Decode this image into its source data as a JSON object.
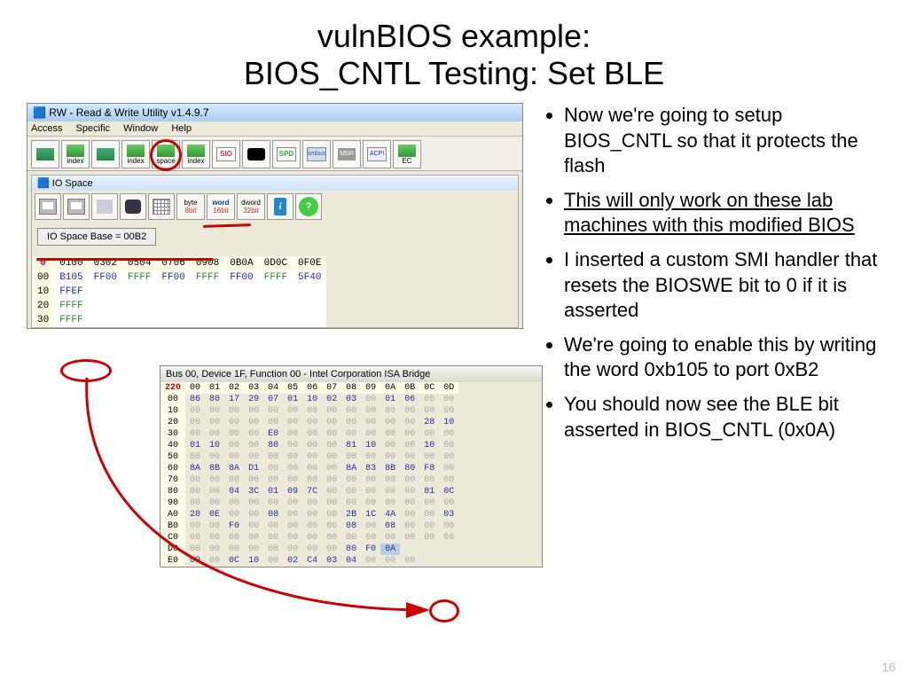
{
  "title_l1": "vulnBIOS example:",
  "title_l2": "BIOS_CNTL Testing: Set BLE",
  "pagenum": "16",
  "bullets": [
    {
      "text": "Now we're going to setup BIOS_CNTL so that it protects the flash"
    },
    {
      "text": "This will only work on these lab machines with this modified BIOS",
      "underline": true
    },
    {
      "text": "I inserted a custom SMI handler that resets the BIOSWE bit to 0 if it is asserted"
    },
    {
      "text": "We're going to enable this by writing the word 0xb105 to port 0xB2"
    },
    {
      "text": "You should now see the BLE bit asserted in BIOS_CNTL (0x0A)"
    }
  ],
  "app": {
    "title": "RW - Read & Write Utility v1.4.9.7",
    "menus": [
      "Access",
      "Specific",
      "Window",
      "Help"
    ],
    "toolbar_labels": [
      "",
      "index",
      "",
      "index",
      "space",
      "index",
      "SIO",
      "",
      "SPD",
      "smbus",
      "MSR",
      "ACPI",
      "EC"
    ]
  },
  "iospace": {
    "title": "IO Space",
    "fmt": [
      {
        "top": "byte",
        "bot": "8bit"
      },
      {
        "top": "word",
        "bot": "16bit"
      },
      {
        "top": "dword",
        "bot": "32bit"
      }
    ],
    "base": "IO Space Base = 00B2",
    "cols": [
      "0",
      "0100",
      "0302",
      "0504",
      "0706",
      "0908",
      "0B0A",
      "0D0C",
      "0F0E"
    ],
    "rows": [
      {
        "h": "00",
        "c": [
          {
            "v": "B105",
            "cls": "blue"
          },
          {
            "v": "FF00",
            "cls": "blue"
          },
          {
            "v": "FFFF",
            "cls": "green"
          },
          {
            "v": "FF00",
            "cls": "blue"
          },
          {
            "v": "FFFF",
            "cls": "green"
          },
          {
            "v": "FF00",
            "cls": "blue"
          },
          {
            "v": "FFFF",
            "cls": "green"
          },
          {
            "v": "5F40",
            "cls": "blue"
          }
        ]
      },
      {
        "h": "10",
        "c": [
          {
            "v": "FFEF",
            "cls": "blue"
          },
          {
            "v": "",
            "cls": ""
          },
          {
            "v": "",
            "cls": ""
          },
          {
            "v": "",
            "cls": ""
          },
          {
            "v": "",
            "cls": ""
          },
          {
            "v": "",
            "cls": ""
          },
          {
            "v": "",
            "cls": ""
          },
          {
            "v": "",
            "cls": ""
          }
        ]
      },
      {
        "h": "20",
        "c": [
          {
            "v": "FFFF",
            "cls": "green"
          },
          {
            "v": "",
            "cls": ""
          },
          {
            "v": "",
            "cls": ""
          },
          {
            "v": "",
            "cls": ""
          },
          {
            "v": "",
            "cls": ""
          },
          {
            "v": "",
            "cls": ""
          },
          {
            "v": "",
            "cls": ""
          },
          {
            "v": "",
            "cls": ""
          }
        ]
      },
      {
        "h": "30",
        "c": [
          {
            "v": "FFFF",
            "cls": "green"
          },
          {
            "v": "",
            "cls": ""
          },
          {
            "v": "",
            "cls": ""
          },
          {
            "v": "",
            "cls": ""
          },
          {
            "v": "",
            "cls": ""
          },
          {
            "v": "",
            "cls": ""
          },
          {
            "v": "",
            "cls": ""
          },
          {
            "v": "",
            "cls": ""
          }
        ]
      }
    ]
  },
  "pci": {
    "title": "Bus 00, Device 1F, Function 00 - Intel Corporation ISA Bridge",
    "cols": [
      "220",
      "00",
      "01",
      "02",
      "03",
      "04",
      "05",
      "06",
      "07",
      "08",
      "09",
      "0A",
      "0B",
      "0C",
      "0D"
    ],
    "rows": [
      {
        "h": "00",
        "c": [
          "86",
          "80",
          "17",
          "29",
          "07",
          "01",
          "10",
          "02",
          "03",
          "00",
          "01",
          "06",
          "00",
          "00"
        ],
        "nz": [
          1,
          1,
          1,
          1,
          1,
          1,
          1,
          1,
          1,
          0,
          1,
          1,
          0,
          0
        ]
      },
      {
        "h": "10",
        "c": [
          "00",
          "00",
          "00",
          "00",
          "00",
          "00",
          "00",
          "00",
          "00",
          "00",
          "00",
          "00",
          "00",
          "00"
        ],
        "nz": [
          0,
          0,
          0,
          0,
          0,
          0,
          0,
          0,
          0,
          0,
          0,
          0,
          0,
          0
        ]
      },
      {
        "h": "20",
        "c": [
          "00",
          "00",
          "00",
          "00",
          "00",
          "00",
          "00",
          "00",
          "00",
          "00",
          "00",
          "00",
          "28",
          "10"
        ],
        "nz": [
          0,
          0,
          0,
          0,
          0,
          0,
          0,
          0,
          0,
          0,
          0,
          0,
          1,
          1
        ]
      },
      {
        "h": "30",
        "c": [
          "00",
          "00",
          "00",
          "00",
          "E0",
          "00",
          "00",
          "00",
          "00",
          "00",
          "00",
          "00",
          "00",
          "00"
        ],
        "nz": [
          0,
          0,
          0,
          0,
          1,
          0,
          0,
          0,
          0,
          0,
          0,
          0,
          0,
          0
        ]
      },
      {
        "h": "40",
        "c": [
          "01",
          "10",
          "00",
          "00",
          "80",
          "00",
          "00",
          "00",
          "81",
          "10",
          "00",
          "00",
          "10",
          "00"
        ],
        "nz": [
          1,
          1,
          0,
          0,
          1,
          0,
          0,
          0,
          1,
          1,
          0,
          0,
          1,
          0
        ]
      },
      {
        "h": "50",
        "c": [
          "00",
          "00",
          "00",
          "00",
          "00",
          "00",
          "00",
          "00",
          "00",
          "00",
          "00",
          "00",
          "00",
          "00"
        ],
        "nz": [
          0,
          0,
          0,
          0,
          0,
          0,
          0,
          0,
          0,
          0,
          0,
          0,
          0,
          0
        ]
      },
      {
        "h": "60",
        "c": [
          "8A",
          "8B",
          "8A",
          "D1",
          "00",
          "00",
          "00",
          "00",
          "8A",
          "83",
          "8B",
          "80",
          "F8",
          "00"
        ],
        "nz": [
          1,
          1,
          1,
          1,
          0,
          0,
          0,
          0,
          1,
          1,
          1,
          1,
          1,
          0
        ]
      },
      {
        "h": "70",
        "c": [
          "00",
          "00",
          "00",
          "00",
          "00",
          "00",
          "00",
          "00",
          "00",
          "00",
          "00",
          "00",
          "00",
          "00"
        ],
        "nz": [
          0,
          0,
          0,
          0,
          0,
          0,
          0,
          0,
          0,
          0,
          0,
          0,
          0,
          0
        ]
      },
      {
        "h": "80",
        "c": [
          "00",
          "00",
          "04",
          "3C",
          "01",
          "09",
          "7C",
          "00",
          "00",
          "00",
          "00",
          "00",
          "81",
          "0C"
        ],
        "nz": [
          0,
          0,
          1,
          1,
          1,
          1,
          1,
          0,
          0,
          0,
          0,
          0,
          1,
          1
        ]
      },
      {
        "h": "90",
        "c": [
          "00",
          "00",
          "00",
          "00",
          "00",
          "00",
          "00",
          "00",
          "00",
          "00",
          "00",
          "00",
          "00",
          "00"
        ],
        "nz": [
          0,
          0,
          0,
          0,
          0,
          0,
          0,
          0,
          0,
          0,
          0,
          0,
          0,
          0
        ]
      },
      {
        "h": "A0",
        "c": [
          "20",
          "0E",
          "00",
          "00",
          "08",
          "00",
          "00",
          "00",
          "2B",
          "1C",
          "4A",
          "00",
          "00",
          "03"
        ],
        "nz": [
          1,
          1,
          0,
          0,
          1,
          0,
          0,
          0,
          1,
          1,
          1,
          0,
          0,
          1
        ]
      },
      {
        "h": "B0",
        "c": [
          "00",
          "00",
          "F0",
          "00",
          "00",
          "00",
          "00",
          "00",
          "08",
          "00",
          "08",
          "00",
          "00",
          "00"
        ],
        "nz": [
          0,
          0,
          1,
          0,
          0,
          0,
          0,
          0,
          1,
          0,
          1,
          0,
          0,
          0
        ]
      },
      {
        "h": "C0",
        "c": [
          "00",
          "00",
          "00",
          "00",
          "00",
          "00",
          "00",
          "00",
          "00",
          "00",
          "00",
          "00",
          "00",
          "00"
        ],
        "nz": [
          0,
          0,
          0,
          0,
          0,
          0,
          0,
          0,
          0,
          0,
          0,
          0,
          0,
          0
        ]
      },
      {
        "h": "D0",
        "c": [
          "00",
          "00",
          "00",
          "00",
          "00",
          "00",
          "00",
          "00",
          "80",
          "F0",
          "0A",
          "",
          "",
          ""
        ],
        "nz": [
          0,
          0,
          0,
          0,
          0,
          0,
          0,
          0,
          1,
          1,
          2,
          0,
          0,
          0
        ]
      },
      {
        "h": "E0",
        "c": [
          "09",
          "00",
          "0C",
          "10",
          "00",
          "02",
          "C4",
          "03",
          "04",
          "00",
          "00",
          "00",
          "",
          ""
        ],
        "nz": [
          1,
          0,
          1,
          1,
          0,
          1,
          1,
          1,
          1,
          0,
          0,
          0,
          0,
          0
        ]
      }
    ]
  }
}
